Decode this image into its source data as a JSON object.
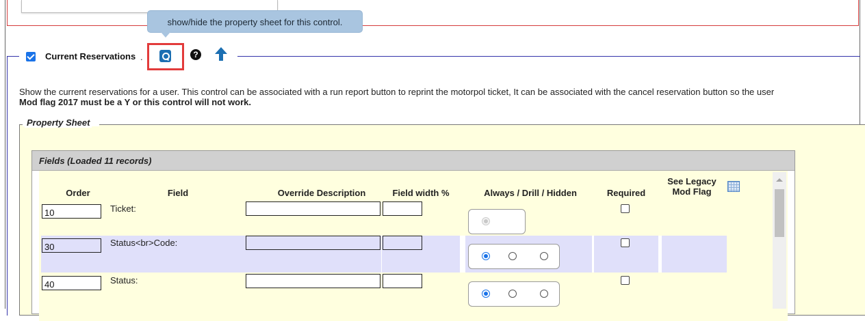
{
  "tooltip": {
    "text": "show/hide the property sheet for this control."
  },
  "control": {
    "checked": true,
    "title": "Current Reservations",
    "separator": ".",
    "icons": {
      "properties": "magnifier-doc-icon",
      "help": "question-circle-icon",
      "move_up": "arrow-up-icon"
    }
  },
  "description": {
    "line1": "Show the current reservations for a user. This control can be associated with a run report button to reprint the motorpol ticket, It can be associated with the cancel reservation button so the user",
    "line2": "Mod flag 2017 must be a Y or this control will not work."
  },
  "property_sheet": {
    "legend": "Property Sheet",
    "fields_panel": {
      "title": "Fields (Loaded 11 records)",
      "columns": {
        "order": "Order",
        "field": "Field",
        "override": "Override Description",
        "width": "Field width %",
        "visibility": "Always / Drill / Hidden",
        "required": "Required",
        "legacy": "See Legacy Mod Flag"
      },
      "rows": [
        {
          "order": "10",
          "field": "Ticket:",
          "override": "",
          "width": "",
          "visibility": "always-disabled",
          "required": false
        },
        {
          "order": "30",
          "field": "Status<br>Code:",
          "override": "",
          "width": "",
          "visibility": "always",
          "required": false
        },
        {
          "order": "40",
          "field": "Status:",
          "override": "",
          "width": "",
          "visibility": "always",
          "required": false
        }
      ]
    }
  },
  "colors": {
    "highlight_row": "#e0e0fa",
    "sheet_bg": "#ffffdf",
    "accent": "#1a73e8",
    "focus_box": "#e23b3b"
  }
}
